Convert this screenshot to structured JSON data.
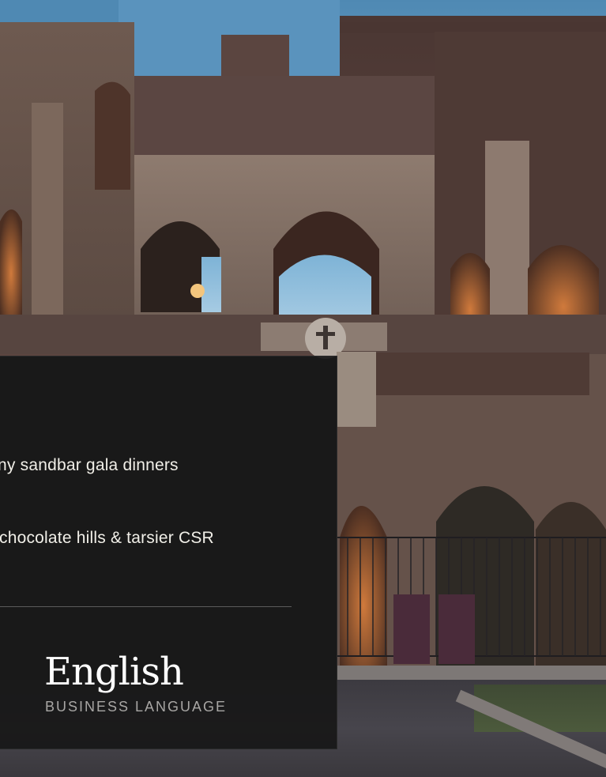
{
  "panel": {
    "items": [
      {
        "label": "ny sandbar gala dinners"
      },
      {
        "label": "chocolate hills & tarsier CSR"
      }
    ],
    "language": {
      "title": "English",
      "subtitle": "BUSINESS LANGUAGE"
    }
  },
  "background": {
    "subject": "Colosseum facade at dusk photo"
  },
  "colors": {
    "panel_bg": "#181818",
    "text_primary": "#ffffff",
    "text_secondary": "#a8a6a4",
    "divider": "#5a5a5a"
  }
}
